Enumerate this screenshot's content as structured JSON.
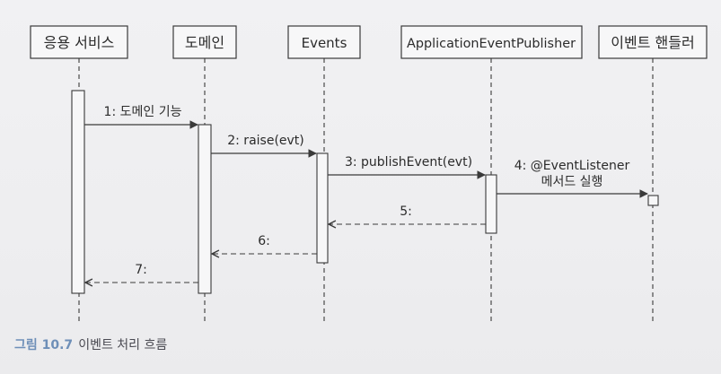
{
  "participants": [
    {
      "id": "app-service",
      "label": "응용 서비스"
    },
    {
      "id": "domain",
      "label": "도메인"
    },
    {
      "id": "events",
      "label": "Events"
    },
    {
      "id": "publisher",
      "label": "ApplicationEventPublisher"
    },
    {
      "id": "event-handler",
      "label": "이벤트 핸들러"
    }
  ],
  "messages": [
    {
      "id": "msg-1",
      "label": "1: 도메인 기능",
      "kind": "call"
    },
    {
      "id": "msg-2",
      "label": "2: raise(evt)",
      "kind": "call"
    },
    {
      "id": "msg-3",
      "label": "3: publishEvent(evt)",
      "kind": "call"
    },
    {
      "id": "msg-4",
      "label_line1": "4: @EventListener",
      "label_line2": "메서드 실행",
      "kind": "call"
    },
    {
      "id": "msg-5",
      "label": "5:",
      "kind": "return"
    },
    {
      "id": "msg-6",
      "label": "6:",
      "kind": "return"
    },
    {
      "id": "msg-7",
      "label": "7:",
      "kind": "return"
    }
  ],
  "caption": {
    "number": "그림 10.7",
    "text": "이벤트 처리 흐름"
  },
  "colors": {
    "line": "#3a3a3a",
    "figure_number": "#6e8fb8"
  }
}
